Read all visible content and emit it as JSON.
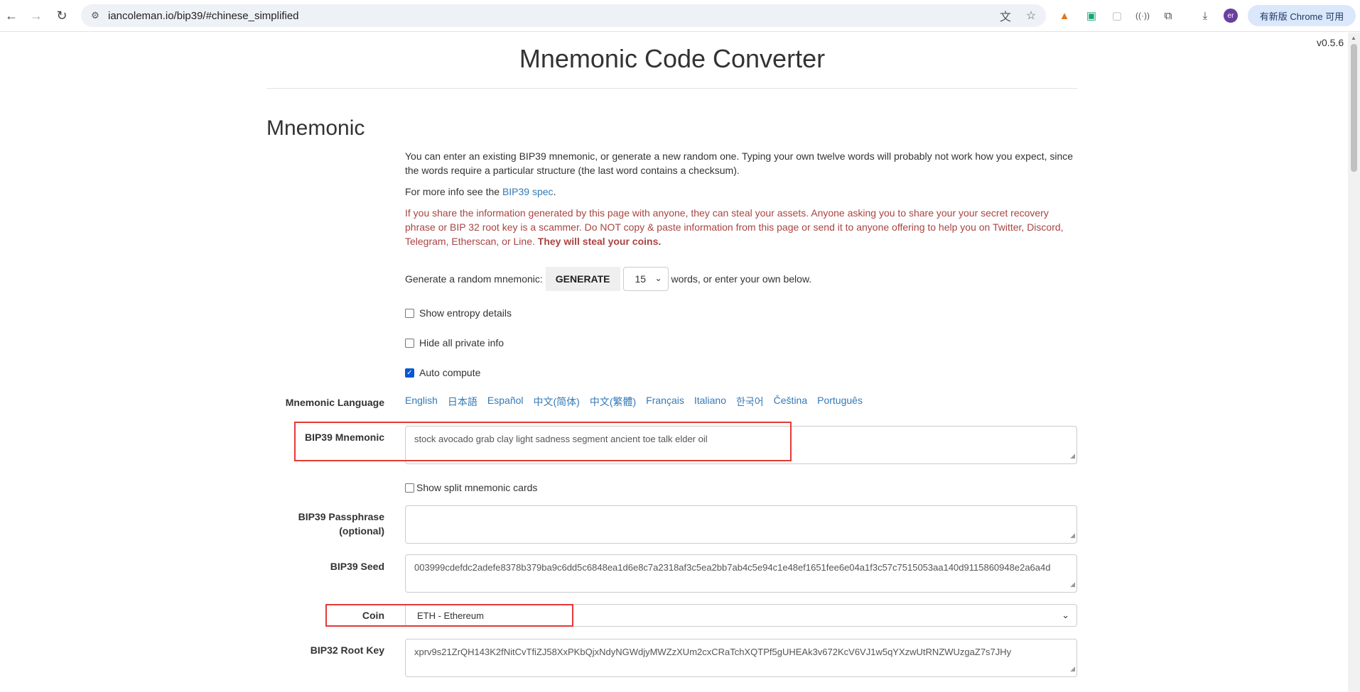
{
  "browser": {
    "url": "iancoleman.io/bip39/#chinese_simplified",
    "avatar_initials": "er",
    "update_label": "有新版 Chrome 可用"
  },
  "page": {
    "version": "v0.5.6",
    "title": "Mnemonic Code Converter",
    "section_title": "Mnemonic",
    "intro": "You can enter an existing BIP39 mnemonic, or generate a new random one. Typing your own twelve words will probably not work how you expect, since the words require a particular structure (the last word contains a checksum).",
    "more_info_prefix": "For more info see the ",
    "more_info_link": "BIP39 spec",
    "more_info_suffix": ".",
    "warning": "If you share the information generated by this page with anyone, they can steal your assets. Anyone asking you to share your your secret recovery phrase or BIP 32 root key is a scammer. Do NOT copy & paste information from this page or send it to anyone offering to help you on Twitter, Discord, Telegram, Etherscan, or Line. ",
    "warning_bold": "They will steal your coins.",
    "generate": {
      "prefix": "Generate a random mnemonic:",
      "button": "GENERATE",
      "word_count": "15",
      "suffix": "words, or enter your own below."
    },
    "checks": {
      "entropy": "Show entropy details",
      "hide_private": "Hide all private info",
      "auto_compute": "Auto compute",
      "split_cards": "Show split mnemonic cards"
    },
    "mnemonic_language_label": "Mnemonic Language",
    "languages": [
      "English",
      "日本語",
      "Español",
      "中文(简体)",
      "中文(繁體)",
      "Français",
      "Italiano",
      "한국어",
      "Čeština",
      "Português"
    ],
    "bip39_mnemonic_label": "BIP39 Mnemonic",
    "bip39_mnemonic_value": "stock avocado grab clay light sadness segment ancient toe talk elder oil",
    "passphrase_label_1": "BIP39 Passphrase",
    "passphrase_label_2": "(optional)",
    "passphrase_value": "",
    "seed_label": "BIP39 Seed",
    "seed_value": "003999cdefdc2adefe8378b379ba9c6dd5c6848ea1d6e8c7a2318af3c5ea2bb7ab4c5e94c1e48ef1651fee6e04a1f3c57c7515053aa140d9115860948e2a6a4d",
    "coin_label": "Coin",
    "coin_value": "ETH - Ethereum",
    "root_key_label": "BIP32 Root Key",
    "root_key_value": "xprv9s21ZrQH143K2fNitCvTfiZJ58XxPKbQjxNdyNGWdjyMWZzXUm2cxCRaTchXQTPf5gUHEAk3v672KcV6VJ1w5qYXzwUtRNZWUzgaZ7s7JHy"
  },
  "icons": {
    "back": "back-arrow-icon",
    "forward": "forward-arrow-icon",
    "reload": "reload-icon",
    "site_info": "site-settings-icon",
    "translate": "translate-icon",
    "bookmark": "star-icon",
    "download": "download-icon",
    "extensions": "puzzle-icon"
  },
  "colors": {
    "link": "#337ab7",
    "danger": "#a94442",
    "highlight_box": "#e53935",
    "checkbox_checked": "#0b57d0"
  }
}
